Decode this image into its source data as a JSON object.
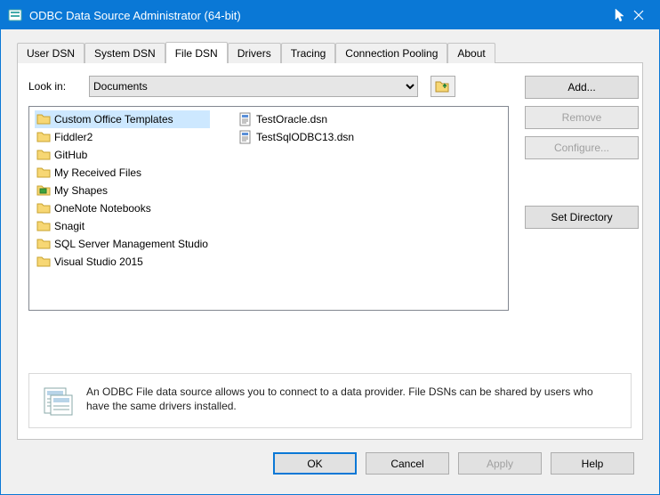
{
  "window": {
    "title": "ODBC Data Source Administrator (64-bit)"
  },
  "tabs": [
    {
      "label": "User DSN"
    },
    {
      "label": "System DSN"
    },
    {
      "label": "File DSN"
    },
    {
      "label": "Drivers"
    },
    {
      "label": "Tracing"
    },
    {
      "label": "Connection Pooling"
    },
    {
      "label": "About"
    }
  ],
  "active_tab_index": 2,
  "look_in": {
    "label": "Look in:",
    "value": "Documents",
    "options": [
      "Documents"
    ]
  },
  "folders": [
    {
      "name": "Custom Office Templates",
      "selected": true,
      "special": false
    },
    {
      "name": "Fiddler2"
    },
    {
      "name": "GitHub"
    },
    {
      "name": "My Received Files"
    },
    {
      "name": "My Shapes",
      "special": true
    },
    {
      "name": "OneNote Notebooks"
    },
    {
      "name": "Snagit"
    },
    {
      "name": "SQL Server Management Studio"
    },
    {
      "name": "Visual Studio 2015"
    }
  ],
  "files": [
    {
      "name": "TestOracle.dsn"
    },
    {
      "name": "TestSqlODBC13.dsn"
    }
  ],
  "side_buttons": {
    "add": "Add...",
    "remove": "Remove",
    "configure": "Configure...",
    "set_directory": "Set Directory"
  },
  "info_text": "An ODBC File data source allows you to connect to a data provider.  File DSNs can be shared by users who have the same drivers installed.",
  "footer": {
    "ok": "OK",
    "cancel": "Cancel",
    "apply": "Apply",
    "help": "Help"
  }
}
